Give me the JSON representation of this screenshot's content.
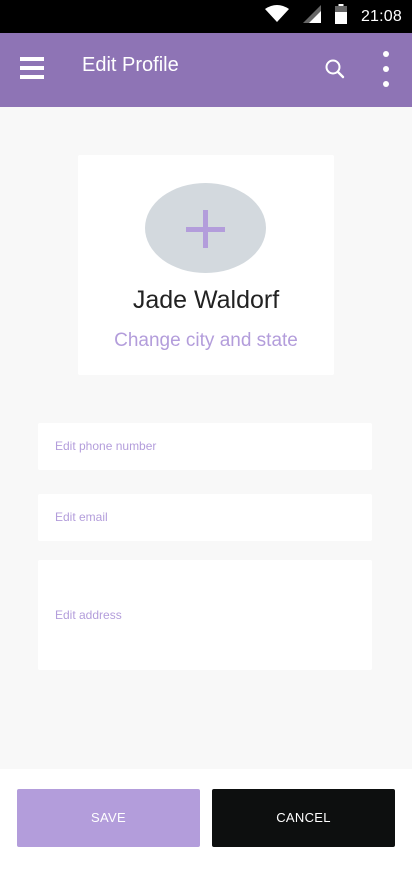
{
  "status_bar": {
    "time": "21:08",
    "icons": [
      "wifi-icon",
      "cell-signal-icon",
      "battery-icon"
    ]
  },
  "app_bar": {
    "title": "Edit Profile",
    "background_color": "#8e74b5",
    "icons": [
      "hamburger-menu-icon",
      "search-icon",
      "more-vert-icon"
    ]
  },
  "profile": {
    "name": "Jade Waldorf",
    "change_location_link": "Change city and state",
    "avatar_icon": "add-photo-plus-icon",
    "accent_color": "#b39ddb"
  },
  "form": {
    "phone_placeholder": "Edit phone number",
    "email_placeholder": "Edit email",
    "address_placeholder": "Edit address"
  },
  "actions": {
    "save_label": "SAVE",
    "cancel_label": "CANCEL"
  }
}
